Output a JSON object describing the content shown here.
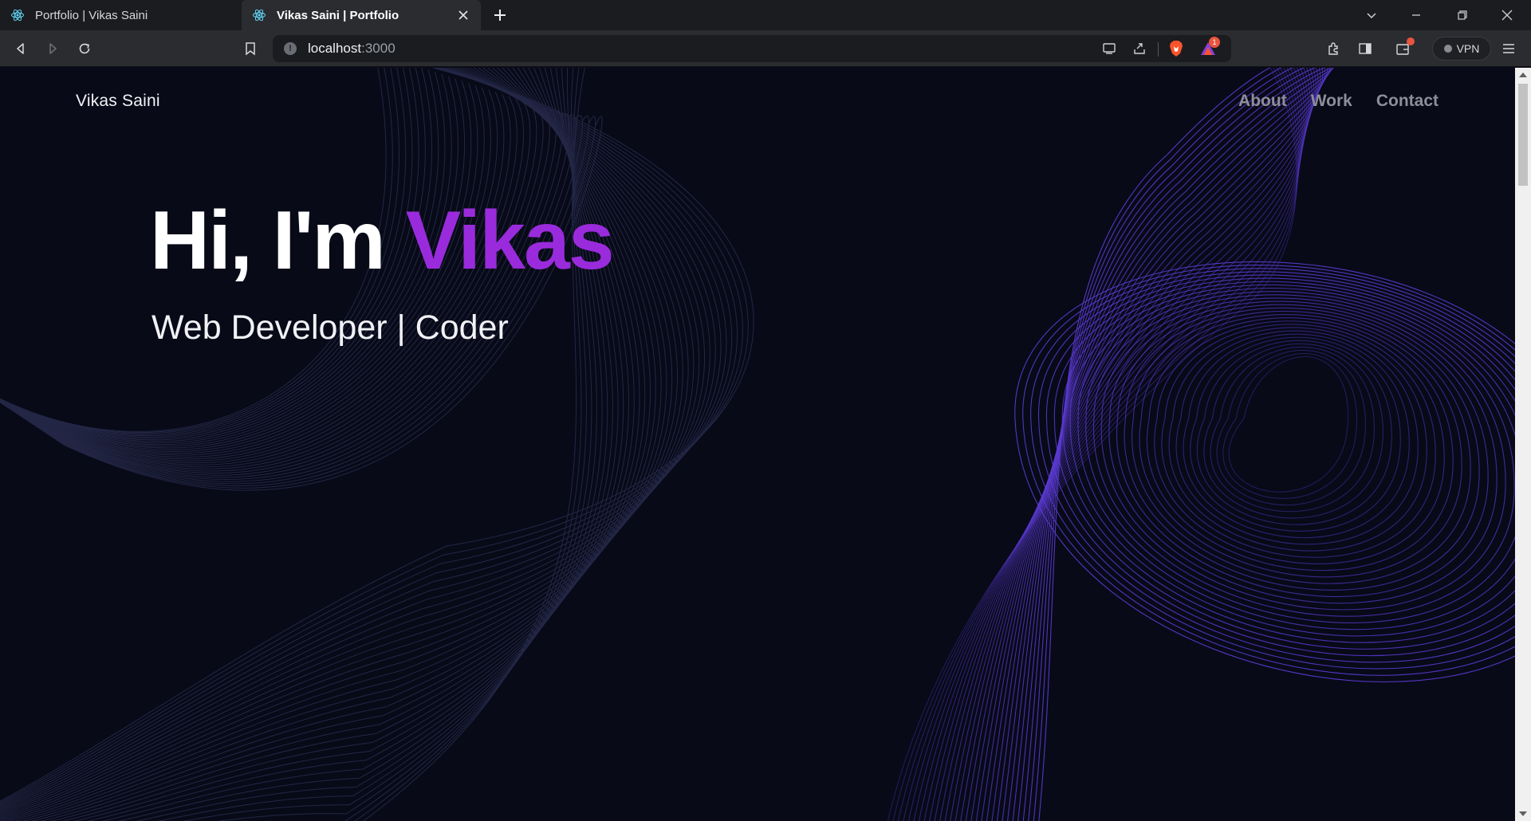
{
  "browser": {
    "tabs": [
      {
        "title": "Portfolio | Vikas Saini",
        "active": false,
        "favicon": "react-icon"
      },
      {
        "title": "Vikas Saini | Portfolio",
        "active": true,
        "favicon": "react-icon"
      }
    ],
    "url_host": "localhost",
    "url_port": ":3000",
    "vpn_label": "VPN",
    "rewards_badge": "1",
    "colors": {
      "tabbar": "#1b1c1f",
      "toolbar": "#2b2c30",
      "brave_orange": "#fb542b"
    }
  },
  "site": {
    "brand": "Vikas Saini",
    "nav": [
      "About",
      "Work",
      "Contact"
    ],
    "hero": {
      "greeting": "Hi, I'm ",
      "name": "Vikas",
      "subtitle": "Web Developer | Coder"
    },
    "colors": {
      "background": "#080a18",
      "accent": "#9a2bdc",
      "nav_text": "#8d8e99",
      "wave_lines": "#5a3ad0"
    }
  }
}
